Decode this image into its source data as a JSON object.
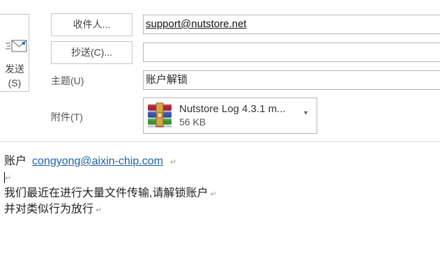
{
  "compose": {
    "send": {
      "line1": "发送",
      "line2": "(S)"
    },
    "to": {
      "button": "收件人...",
      "value": "support@nutstore.net"
    },
    "cc": {
      "button": "抄送(C)...",
      "value": ""
    },
    "subject": {
      "label": "主题(U)",
      "value": "账户解锁"
    },
    "attachments": {
      "label": "附件(T)",
      "items": [
        {
          "name": "Nutstore Log 4.3.1 m...",
          "size": "56 KB",
          "icon": "winrar-archive-icon"
        }
      ]
    }
  },
  "body": {
    "line1_text": "账户",
    "line1_link": "congyong@aixin-chip.com",
    "line3": "我们最近在进行大量文件传输,请解锁账户",
    "line4": "并对类似行为放行",
    "paragraph_mark": "↵"
  }
}
